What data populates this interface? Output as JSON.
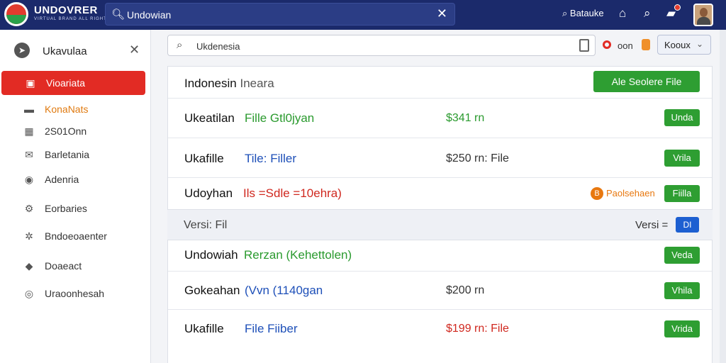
{
  "topbar": {
    "brand_title": "UNDOVRER",
    "brand_sub": "VIRTUAL BRAND ALL RIGHT BEIN",
    "search_value": "Undowian",
    "user_text": "Batauke"
  },
  "sidebar": {
    "header": "Ukavulaa",
    "items": [
      {
        "label": "Vioariata",
        "icon": "document-icon"
      },
      {
        "label": "KonaNats",
        "icon": "folder-icon"
      },
      {
        "label": "2S01Onn",
        "icon": "grid-icon"
      },
      {
        "label": "Barletania",
        "icon": "mail-icon"
      },
      {
        "label": "Adenria",
        "icon": "circle-badge-icon"
      },
      {
        "label": "Eorbaries",
        "icon": "cog-icon"
      },
      {
        "label": "Bndoeoaenter",
        "icon": "settings-icon"
      },
      {
        "label": "Doaeact",
        "icon": "shield-icon"
      },
      {
        "label": "Uraoonhesah",
        "icon": "target-icon"
      }
    ]
  },
  "main": {
    "search_value": "Ukdenesia",
    "rec_label": "oon",
    "select_label": "Kooux",
    "panel_title": "Indonesin",
    "panel_title_sub": "Ineara",
    "cta_label": "Ale Seolere File",
    "rows_top": [
      {
        "name": "Ukeatilan",
        "desc": "Fille Gtl0jyan",
        "desc_color": "green",
        "price": "$341 rn",
        "price_color": "green",
        "btn": "Unda"
      },
      {
        "name": "Ukafille",
        "desc": "Tile: Filler",
        "desc_color": "blue",
        "price": "$250 rn: File",
        "price_color": "dark",
        "btn": "Vrila"
      },
      {
        "name": "Udoyhan",
        "desc": "Ils =Sdle =10ehra)",
        "desc_color": "red",
        "warn_icon": "B",
        "warn_text": "Paolsehaen",
        "btn": "Fiilla"
      }
    ],
    "version_label": "Versi: Fil",
    "version_label2": "Versi =",
    "version_btn": "DI",
    "rows_bottom": [
      {
        "name": "Undowiah",
        "desc": "Rerzan (Kehettolen)",
        "desc_color": "green",
        "price": "",
        "price_color": "dark",
        "btn": "Veda"
      },
      {
        "name": "Gokeahan",
        "desc": "(Vvn (1140gan",
        "desc_color": "blue",
        "price": "$200 rn",
        "price_color": "dark",
        "btn": "Vhila"
      },
      {
        "name": "Ukafille",
        "desc": "File Fiiber",
        "desc_color": "blue",
        "price": "$199 rn: File",
        "price_color": "red",
        "btn": "Vrida"
      }
    ]
  }
}
